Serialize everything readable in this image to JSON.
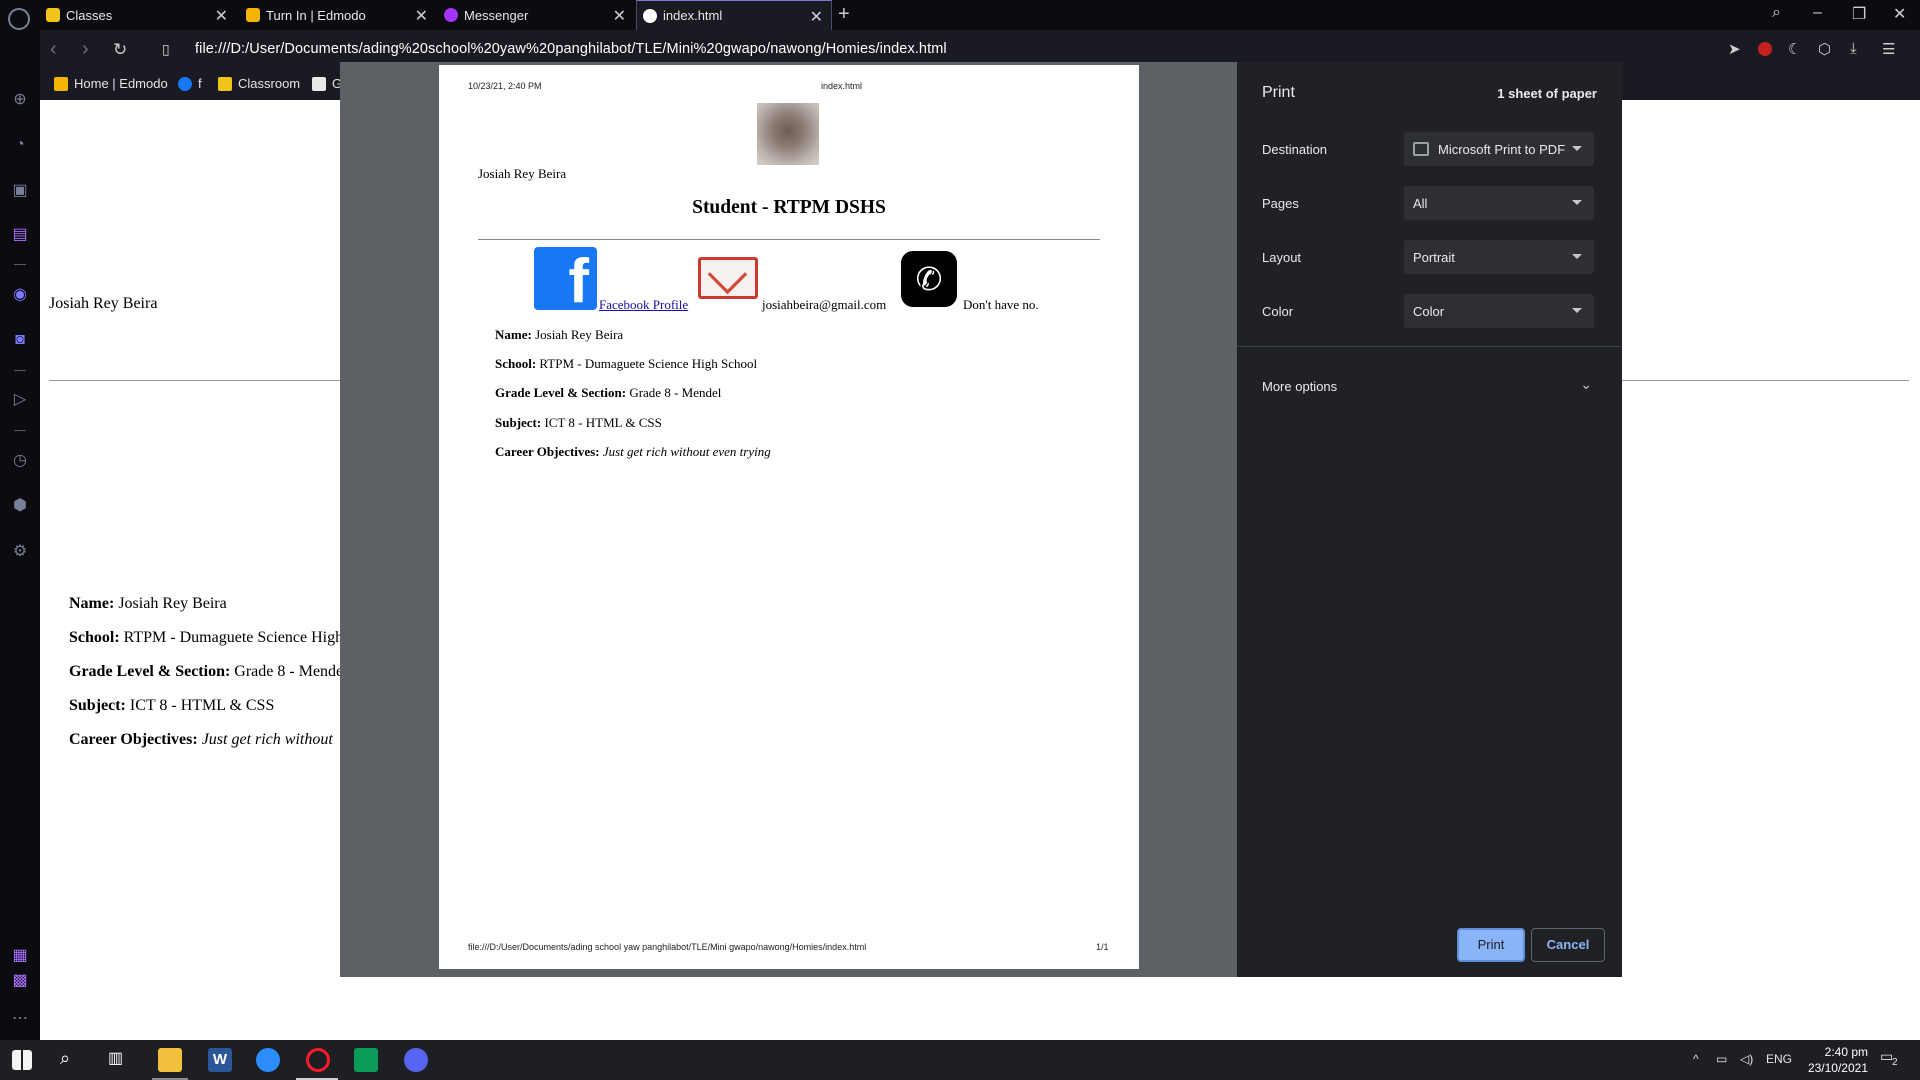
{
  "browser": {
    "tabs": [
      {
        "label": "Classes",
        "favicon_color": "#f0c419"
      },
      {
        "label": "Turn In | Edmodo",
        "favicon_color": "#f4b400"
      },
      {
        "label": "Messenger",
        "favicon_color": "#a334fa"
      },
      {
        "label": "index.html",
        "favicon_color": "#ffffff"
      }
    ],
    "url": "file:///D:/User/Documents/ading%20school%20yaw%20panghilabot/TLE/Mini%20gwapo/nawong/Homies/index.html",
    "bookmarks": [
      {
        "label": "Home | Edmodo"
      },
      {
        "label": "f"
      },
      {
        "label": "Classroom"
      },
      {
        "label": "G"
      }
    ]
  },
  "webpage": {
    "name": "Josiah Rey Beira",
    "info": [
      {
        "label": "Name:",
        "value": "Josiah Rey Beira"
      },
      {
        "label": "School:",
        "value": "RTPM - Dumaguete Science High"
      },
      {
        "label": "Grade Level & Section:",
        "value": "Grade 8 - Mende"
      },
      {
        "label": "Subject:",
        "value": "ICT 8 - HTML & CSS"
      },
      {
        "label": "Career Objectives:",
        "value": "Just get rich without"
      }
    ]
  },
  "preview": {
    "header_date": "10/23/21, 2:40 PM",
    "header_title": "index.html",
    "name": "Josiah Rey Beira",
    "heading": "Student - RTPM DSHS",
    "facebook_link": "Facebook Profile",
    "email": "josiahbeira@gmail.com",
    "phone": "Don't have no.",
    "info": [
      {
        "label": "Name:",
        "value": "Josiah Rey Beira"
      },
      {
        "label": "School:",
        "value": "RTPM - Dumaguete Science High School"
      },
      {
        "label": "Grade Level & Section:",
        "value": "Grade 8 - Mendel"
      },
      {
        "label": "Subject:",
        "value": "ICT 8 - HTML & CSS"
      },
      {
        "label": "Career Objectives:",
        "value": "Just get rich without even trying"
      }
    ],
    "footer_path": "file:///D:/User/Documents/ading school yaw panghilabot/TLE/Mini gwapo/nawong/Homies/index.html",
    "footer_page": "1/1"
  },
  "print_panel": {
    "title": "Print",
    "sheets": "1 sheet of paper",
    "destination_label": "Destination",
    "destination_value": "Microsoft Print to PDF",
    "pages_label": "Pages",
    "pages_value": "All",
    "layout_label": "Layout",
    "layout_value": "Portrait",
    "color_label": "Color",
    "color_value": "Color",
    "more_options": "More options",
    "print_button": "Print",
    "cancel_button": "Cancel"
  },
  "taskbar": {
    "language": "ENG",
    "time": "2:40 pm",
    "date": "23/10/2021",
    "notifications": "2"
  },
  "colors": {
    "accent_blue": "#8ab4f8",
    "panel_bg": "#202124",
    "facebook_blue": "#1877f2",
    "gmail_red": "#d44638"
  }
}
